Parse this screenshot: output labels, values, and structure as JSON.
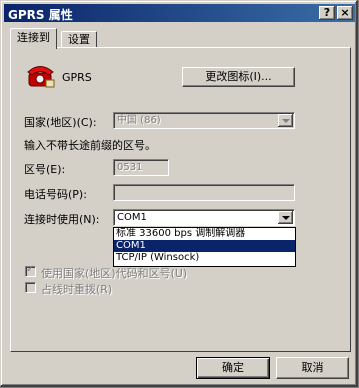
{
  "window": {
    "title": "GPRS 属性",
    "help_label": "?",
    "close_label": "×"
  },
  "tabs": [
    {
      "label": "连接到"
    },
    {
      "label": "设置"
    }
  ],
  "connection": {
    "name": "GPRS",
    "change_icon_label": "更改图标(I)..."
  },
  "country": {
    "label": "国家(地区)(C):",
    "value": "中国 (86)"
  },
  "hint": "输入不带长途前缀的区号。",
  "area_code": {
    "label": "区号(E):",
    "value": "0531"
  },
  "phone": {
    "label": "电话号码(P):",
    "value": ""
  },
  "connect_using": {
    "label": "连接时使用(N):",
    "value": "COM1",
    "options": [
      "标准 33600 bps 调制解调器",
      "COM1",
      "TCP/IP (Winsock)"
    ],
    "selected_index": 1
  },
  "use_country_code": {
    "label": "使用国家(地区)代码和区号(U)",
    "checked": true
  },
  "redial": {
    "label": "占线时重拨(R)",
    "checked": false
  },
  "buttons": {
    "ok": "确定",
    "cancel": "取消"
  }
}
